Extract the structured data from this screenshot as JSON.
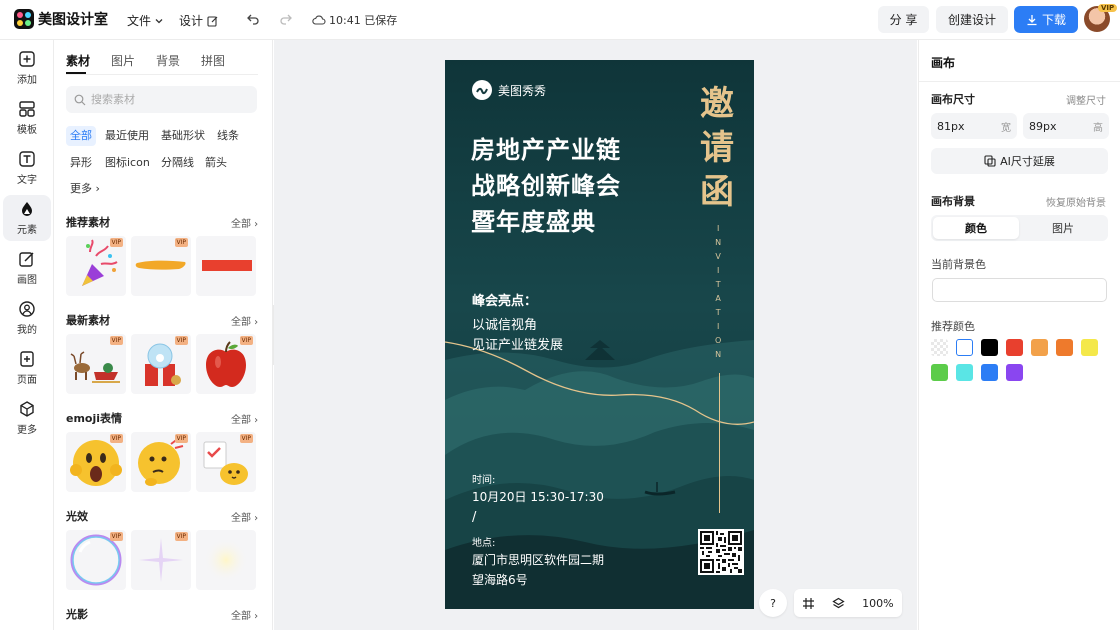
{
  "app": {
    "name": "美图设计室",
    "menu_file": "文件",
    "menu_design": "设计",
    "save_status": "10:41 已保存",
    "share": "分 享",
    "create_design": "创建设计",
    "download": "下载",
    "vip_badge": "VIP",
    "brand_colors": {
      "primary": "#2c7df5",
      "canvas_bg": "#173c40",
      "gold": "#e5c48c"
    }
  },
  "rail": [
    {
      "label": "添加",
      "icon": "plus-square-icon"
    },
    {
      "label": "模板",
      "icon": "template-icon"
    },
    {
      "label": "文字",
      "icon": "text-icon"
    },
    {
      "label": "元素",
      "icon": "shapes-icon",
      "active": true
    },
    {
      "label": "画图",
      "icon": "pen-icon"
    },
    {
      "label": "我的",
      "icon": "user-icon"
    },
    {
      "label": "页面",
      "icon": "page-add-icon"
    },
    {
      "label": "更多",
      "icon": "cube-icon"
    }
  ],
  "panel": {
    "tabs": [
      "素材",
      "图片",
      "背景",
      "拼图"
    ],
    "search_placeholder": "搜索素材",
    "chips": [
      "全部",
      "最近使用",
      "基础形状",
      "线条",
      "异形",
      "图标icon",
      "分隔线",
      "箭头",
      "更多"
    ],
    "all_label": "全部",
    "sections": [
      "推荐素材",
      "最新素材",
      "emoji表情",
      "光效",
      "光影"
    ]
  },
  "poster": {
    "brand": "美图秀秀",
    "title_lines": [
      "房地产产业链",
      "战略创新峰会",
      "暨年度盛典"
    ],
    "invite_chars": [
      "邀",
      "请",
      "函"
    ],
    "invitation_letters": [
      "I",
      "N",
      "V",
      "I",
      "T",
      "A",
      "T",
      "I",
      "O",
      "N"
    ],
    "highlight_title": "峰会亮点：",
    "highlight_lines": [
      "以诚信视角",
      "见证产业链发展"
    ],
    "time_label": "时间:",
    "time_value": "10月20日 15:30-17:30",
    "slash": "/",
    "place_label": "地点:",
    "place_lines": [
      "厦门市思明区软件园二期",
      "望海路6号"
    ]
  },
  "zoom": {
    "help": "?",
    "value": "100%"
  },
  "right": {
    "title": "画布",
    "size_label": "画布尺寸",
    "adjust_size": "调整尺寸",
    "width_value": "81px",
    "width_unit": "宽",
    "height_value": "89px",
    "height_unit": "高",
    "ai_extend": "AI尺寸延展",
    "bg_label": "画布背景",
    "restore_bg": "恢复原始背景",
    "seg_color": "颜色",
    "seg_image": "图片",
    "current_bg": "当前背景色",
    "recommend": "推荐颜色",
    "swatches": [
      "transparent",
      "#ffffff",
      "#000000",
      "#e8402e",
      "#f2a14a",
      "#ee7a2c",
      "#f4e84a",
      "#5ccc4a",
      "#5ae5e5",
      "#2c7df5",
      "#8a46f0"
    ]
  }
}
